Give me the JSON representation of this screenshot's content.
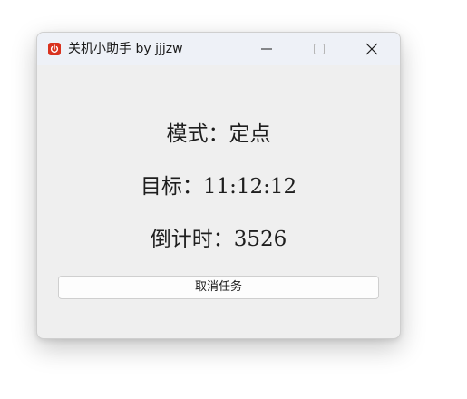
{
  "window": {
    "title": "关机小助手 by jjjzw",
    "icon": "power-icon",
    "controls": [
      "minimize-icon",
      "maximize-icon",
      "close-icon"
    ]
  },
  "content": {
    "mode_line": "模式：定点",
    "target_line": "目标：11:12:12",
    "countdown_line": "倒计时：3526",
    "cancel_label": "取消任务"
  },
  "colors": {
    "window_bg": "#efefef",
    "titlebar_bg": "#eef1f7",
    "icon_red": "#d9321f"
  }
}
